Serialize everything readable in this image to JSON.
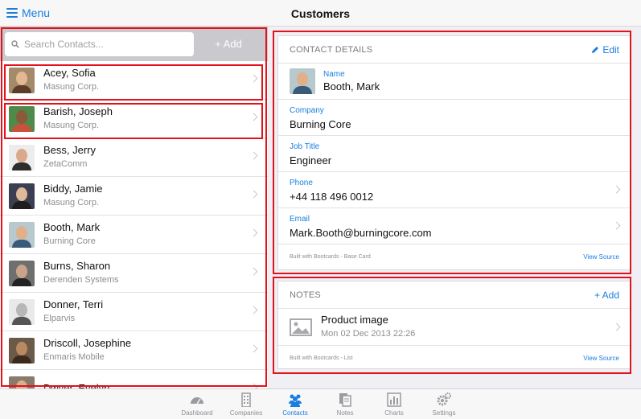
{
  "navbar": {
    "menu_label": "Menu",
    "title": "Customers"
  },
  "search": {
    "placeholder": "Search Contacts...",
    "add_label": "+ Add"
  },
  "contacts": [
    {
      "name": "Acey, Sofia",
      "company": "Masung Corp."
    },
    {
      "name": "Barish, Joseph",
      "company": "Masung Corp."
    },
    {
      "name": "Bess, Jerry",
      "company": "ZetaComm"
    },
    {
      "name": "Biddy, Jamie",
      "company": "Masung Corp."
    },
    {
      "name": "Booth, Mark",
      "company": "Burning Core"
    },
    {
      "name": "Burns, Sharon",
      "company": "Derenden Systems"
    },
    {
      "name": "Donner, Terri",
      "company": "Elparvis"
    },
    {
      "name": "Driscoll, Josephine",
      "company": "Enmaris Mobile"
    },
    {
      "name": "Dwyer, Evelyn",
      "company": ""
    }
  ],
  "details": {
    "header": "CONTACT DETAILS",
    "edit_label": "Edit",
    "name_label": "Name",
    "name_value": "Booth, Mark",
    "company_label": "Company",
    "company_value": "Burning Core",
    "job_label": "Job Title",
    "job_value": "Engineer",
    "phone_label": "Phone",
    "phone_value": "+44 118 496 0012",
    "email_label": "Email",
    "email_value": "Mark.Booth@burningcore.com",
    "footer_note": "Built with Bootcards - Base Card",
    "footer_link": "View Source"
  },
  "notes": {
    "header": "NOTES",
    "add_label": "+ Add",
    "item_title": "Product image",
    "item_date": "Mon 02 Dec 2013 22:26",
    "footer_note": "Built with Bootcards - List",
    "footer_link": "View Source"
  },
  "tabs": [
    {
      "label": "Dashboard",
      "icon": "dashboard-icon"
    },
    {
      "label": "Companies",
      "icon": "building-icon"
    },
    {
      "label": "Contacts",
      "icon": "users-icon"
    },
    {
      "label": "Notes",
      "icon": "notes-icon"
    },
    {
      "label": "Charts",
      "icon": "bar-chart-icon"
    },
    {
      "label": "Settings",
      "icon": "gears-icon"
    }
  ],
  "colors": {
    "accent": "#1a7ee0",
    "highlight": "#e3111b",
    "background": "#efeff4"
  }
}
